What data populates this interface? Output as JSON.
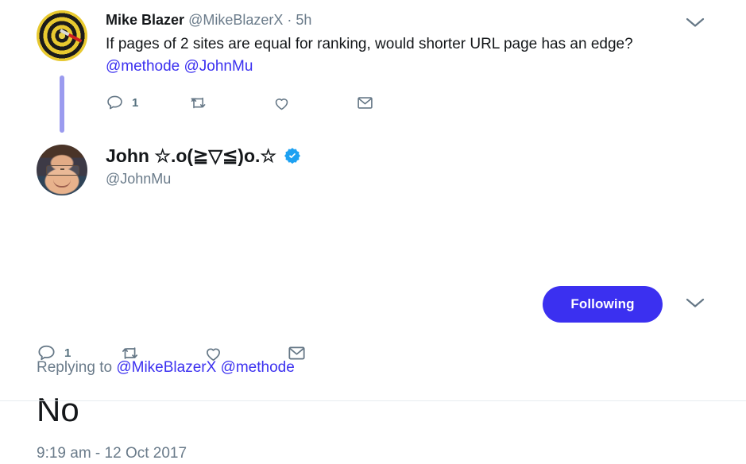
{
  "colors": {
    "link": "#3b30f0",
    "follow_button_bg": "#3b30f0",
    "verified_badge": "#1da1f2",
    "icon_gray": "#657786",
    "muted_text": "#6a7b8a",
    "thread_line": "#9b9bef",
    "divider": "#e6ecf0",
    "background": "#ffffff"
  },
  "parent_tweet": {
    "avatar_name": "dartboard-avatar",
    "display_name": "Mike Blazer",
    "handle": "@MikeBlazerX",
    "meta_separator": "·",
    "time_ago": "5h",
    "text_part1": "If pages of 2 sites are equal for ranking, would shorter URL page has an edge? ",
    "mentions": [
      "@methode",
      "@JohnMu"
    ],
    "caret_icon": "chevron-down-icon",
    "actions": [
      {
        "icon": "reply-icon",
        "label": "Reply",
        "count": "1"
      },
      {
        "icon": "retweet-icon",
        "label": "Retweet",
        "count": ""
      },
      {
        "icon": "like-icon",
        "label": "Like",
        "count": ""
      },
      {
        "icon": "share-icon",
        "label": "Direct message",
        "count": ""
      }
    ]
  },
  "main_tweet": {
    "avatar_name": "john-mueller-avatar",
    "display_name": "John ☆.o(≧▽≦)o.☆",
    "verified": true,
    "verified_icon": "verified-badge-icon",
    "handle": "@JohnMu",
    "follow_button_label": "Following",
    "caret_icon": "chevron-down-icon",
    "replying_to_prefix": "Replying to ",
    "replying_to_mentions": [
      "@MikeBlazerX",
      "@methode"
    ],
    "text": "No",
    "timestamp": "9:19 am - 12 Oct 2017",
    "actions": [
      {
        "icon": "reply-icon",
        "label": "Reply",
        "count": "1"
      },
      {
        "icon": "retweet-icon",
        "label": "Retweet",
        "count": ""
      },
      {
        "icon": "like-icon",
        "label": "Like",
        "count": ""
      },
      {
        "icon": "share-icon",
        "label": "Direct message",
        "count": ""
      }
    ]
  }
}
